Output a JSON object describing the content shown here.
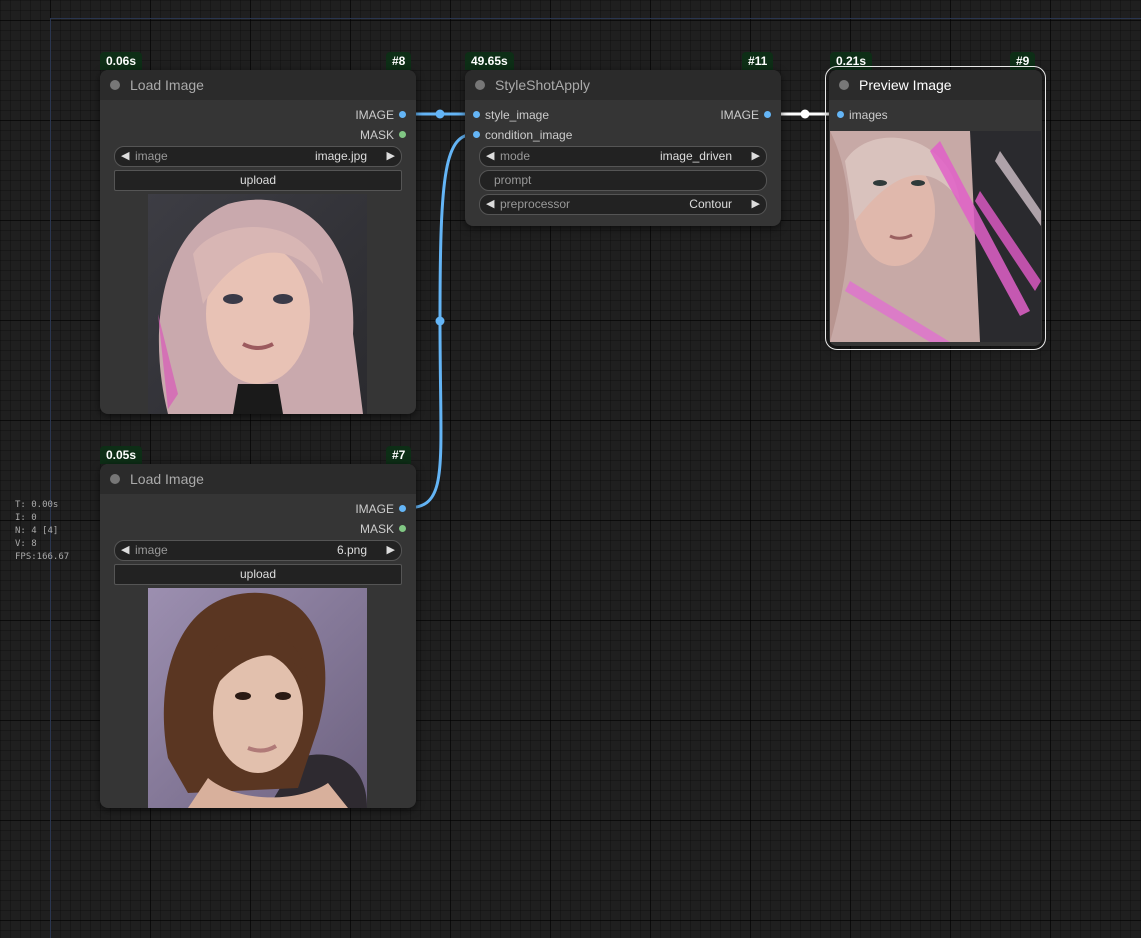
{
  "nodes": {
    "load_image_8": {
      "time": "0.06s",
      "id": "#8",
      "title": "Load Image",
      "outputs": [
        "IMAGE",
        "MASK"
      ],
      "widget_name": "image",
      "widget_value": "image.jpg",
      "button": "upload"
    },
    "load_image_7": {
      "time": "0.05s",
      "id": "#7",
      "title": "Load Image",
      "outputs": [
        "IMAGE",
        "MASK"
      ],
      "widget_name": "image",
      "widget_value": "6.png",
      "button": "upload"
    },
    "styleshot": {
      "time": "49.65s",
      "id": "#11",
      "title": "StyleShotApply",
      "inputs": [
        "style_image",
        "condition_image"
      ],
      "outputs": [
        "IMAGE"
      ],
      "mode_name": "mode",
      "mode_value": "image_driven",
      "prompt_placeholder": "prompt",
      "pre_name": "preprocessor",
      "pre_value": "Contour"
    },
    "preview": {
      "time": "0.21s",
      "id": "#9",
      "title": "Preview Image",
      "inputs": [
        "images"
      ]
    }
  },
  "stats": {
    "t": "T: 0.00s",
    "i": "I: 0",
    "n": "N: 4 [4]",
    "v": "V: 8",
    "fps": "FPS:166.67"
  },
  "colors": {
    "image_link": "#64b5f6",
    "mask_slot": "#81c784",
    "badge_bg": "#0d2e16"
  }
}
